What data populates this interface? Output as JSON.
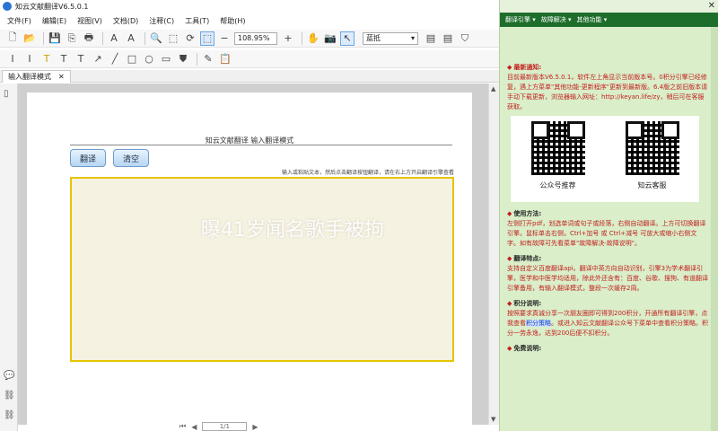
{
  "window": {
    "title": "知云文献翻译V6.5.0.1"
  },
  "menu": [
    "文件(F)",
    "编辑(E)",
    "视图(V)",
    "文档(D)",
    "注释(C)",
    "工具(T)",
    "帮助(H)"
  ],
  "toolbar": {
    "zoom": "108.95%",
    "mode": "蓝抵"
  },
  "doc_tab": {
    "label": "输入翻译模式"
  },
  "page": {
    "title": "知云文献翻译 输入翻译模式",
    "translate_button": "翻译",
    "clear_button": "清空",
    "hint": "输入或粘贴文本，然后点击翻译按钮翻译，请在右上方开启翻译引擎查看"
  },
  "bottom_nav": {
    "page_value": "1/1"
  },
  "right_panel": {
    "nav": [
      "翻译引擎",
      "故障解决",
      "其他功能"
    ],
    "sections": {
      "news_title": "最新通知:",
      "news_text": "目前最新版本V6.5.0.1，软件左上角显示当前版本号。0积分引擎已经修复，遇上方菜单\"其他功能-更新程序\"更新到最新版。6.4版之前旧版本请手动下载更新，浏览器输入网址：http://keyan.life/zy，稍后可在客服获取。",
      "qr_left_label": "公众号推荐",
      "qr_right_label": "知云客服",
      "usage_title": "使用方法:",
      "usage_text": "左侧打开pdf，划选单词或句子或段落，右侧自动翻译。上方可切换翻译引擎。鼠标单击右侧，Ctrl+加号 或 Ctrl+减号 可放大或缩小右侧文字。如有故障可先看菜单\"故障解决-故障说明\"。",
      "features_title": "翻译特点:",
      "features_text": "支持自定义百度翻译api。翻译中英方向自动识别，引擎3为学术翻译引擎，医学和中医学均适用，除此外还含有：百度、谷歌、搜狗、有道翻译引擎备用，有输入翻译模式，整段一次缓存2周。",
      "points_title": "积分说明:",
      "points_text_1": "按照要求真诚分享一次朋友圈即可得到200积分，开通所有翻译引擎，点我查看",
      "points_link": "积分策略",
      "points_text_2": "。或进入知云文献翻译公众号下菜单中查看积分策略。积分一劳永逸，达到200后便不扣积分。",
      "free_title": "免费说明:"
    }
  },
  "overlay_text": "曝41岁闻名歌手被拘"
}
